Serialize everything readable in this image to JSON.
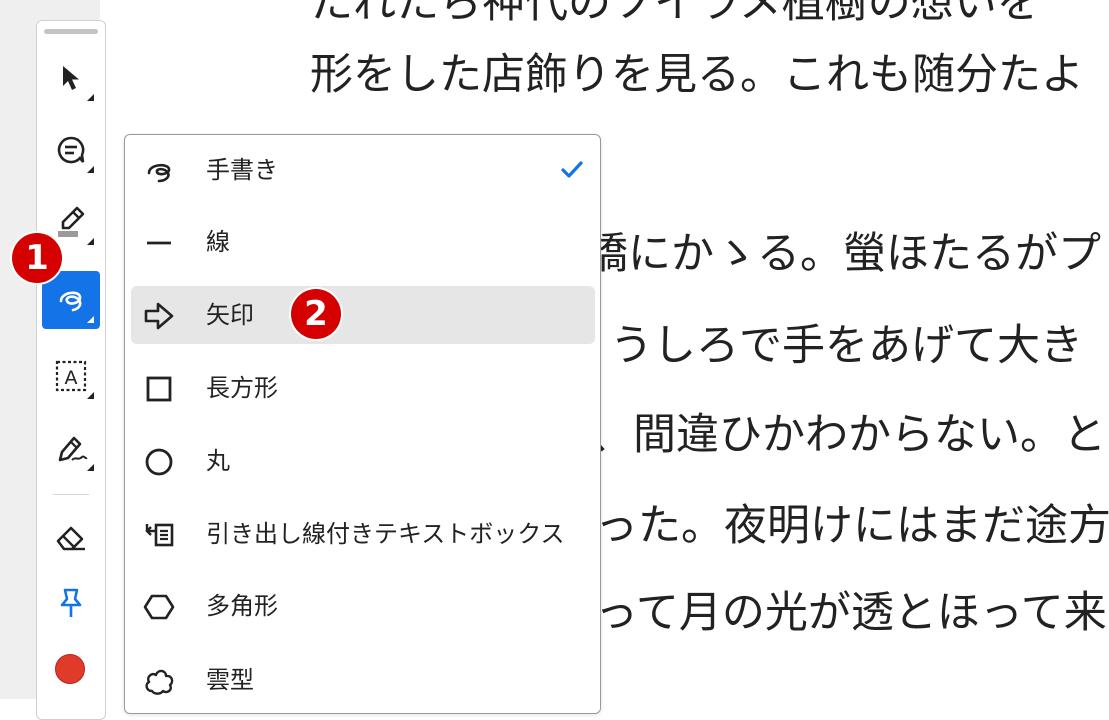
{
  "document": {
    "lines": [
      "たれたら神代のソイラメ植樹の想いを",
      "形をした店飾りを見る。これも随分たよ",
      "橋にかゝる。螢ほたるがプ",
      "うしろで手をあげて大き",
      "、間違ひかわからない。と",
      "った。夜明けにはまだ途方",
      "って月の光が透とほって来"
    ]
  },
  "toolbar": {
    "tools": [
      {
        "name": "select",
        "icon": "cursor-arrow-icon"
      },
      {
        "name": "comment",
        "icon": "comment-icon"
      },
      {
        "name": "highlight",
        "icon": "highlighter-icon"
      },
      {
        "name": "draw",
        "icon": "freehand-draw-icon",
        "active": true
      },
      {
        "name": "text-box",
        "icon": "text-box-icon"
      },
      {
        "name": "signature",
        "icon": "signature-pen-icon"
      },
      {
        "name": "eraser",
        "icon": "eraser-icon"
      },
      {
        "name": "pin",
        "icon": "pushpin-icon"
      },
      {
        "name": "color",
        "icon": "color-swatch",
        "color": "#e03a2a"
      }
    ]
  },
  "menu": {
    "items": [
      {
        "label": "手書き",
        "icon": "freehand-icon",
        "checked": true
      },
      {
        "label": "線",
        "icon": "line-icon"
      },
      {
        "label": "矢印",
        "icon": "arrow-icon",
        "highlighted": true
      },
      {
        "label": "長方形",
        "icon": "rectangle-icon"
      },
      {
        "label": "丸",
        "icon": "circle-icon"
      },
      {
        "label": "引き出し線付きテキストボックス",
        "icon": "callout-icon"
      },
      {
        "label": "多角形",
        "icon": "polygon-icon"
      },
      {
        "label": "雲型",
        "icon": "cloud-icon"
      }
    ]
  },
  "badges": {
    "first": "1",
    "second": "2"
  },
  "colors": {
    "accent": "#1473e6",
    "badge": "#d50000",
    "check": "#1473e6"
  }
}
